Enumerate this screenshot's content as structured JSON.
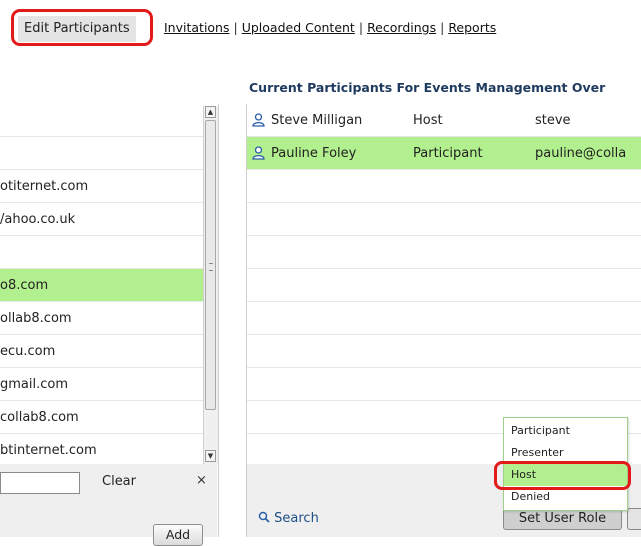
{
  "tabs": {
    "edit_participants": "Edit Participants",
    "invitations": "Invitations",
    "uploaded_content": "Uploaded Content",
    "recordings": "Recordings",
    "reports": "Reports",
    "separator": "|"
  },
  "current_participants": {
    "title": "Current Participants For Events Management Over",
    "rows": [
      {
        "name": "Steve Milligan",
        "role": "Host",
        "username": "steve",
        "selected": false
      },
      {
        "name": "Pauline Foley",
        "role": "Participant",
        "username": "pauline@colla",
        "selected": true
      }
    ],
    "search_label": "Search",
    "set_role_label": "Set User Role"
  },
  "available_users": {
    "rows": [
      {
        "text": "",
        "selected": false
      },
      {
        "text": "",
        "selected": false
      },
      {
        "text": "otiternet.com",
        "selected": false
      },
      {
        "text": "/ahoo.co.uk",
        "selected": false
      },
      {
        "text": "",
        "selected": false
      },
      {
        "text": "o8.com",
        "selected": true
      },
      {
        "text": "ollab8.com",
        "selected": false
      },
      {
        "text": "ecu.com",
        "selected": false
      },
      {
        "text": "gmail.com",
        "selected": false
      },
      {
        "text": "collab8.com",
        "selected": false
      },
      {
        "text": "btinternet.com",
        "selected": false
      }
    ],
    "search_value": "",
    "clear_label": "Clear",
    "clear_x": "×",
    "add_label": "Add"
  },
  "role_menu": {
    "options": [
      "Participant",
      "Presenter",
      "Host",
      "Denied"
    ],
    "selected": "Host"
  },
  "colors": {
    "selection": "#b2ef8e",
    "highlight_ring": "#e21a1a",
    "heading": "#1e3a5f",
    "link": "#1e4f86"
  },
  "icons": {
    "user": "user-icon",
    "search": "magnifier-icon",
    "scroll_up": "arrow-up-icon",
    "scroll_down": "arrow-down-icon"
  }
}
